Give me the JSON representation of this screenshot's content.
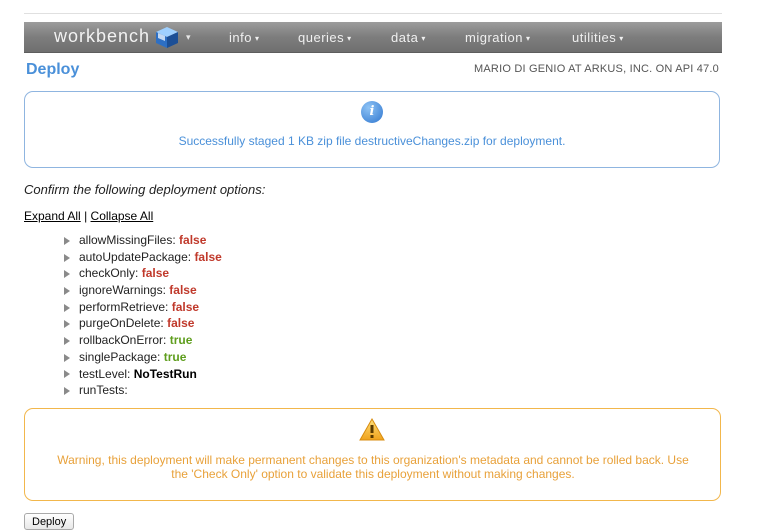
{
  "header": {
    "logo_text": "workbench",
    "nav_items": [
      "info",
      "queries",
      "data",
      "migration",
      "utilities"
    ],
    "caret": "▾"
  },
  "page": {
    "title": "Deploy",
    "user_info": "MARIO DI GENIO AT ARKUS, INC. ON API 47.0"
  },
  "info_box": {
    "icon": "info-icon",
    "message": "Successfully staged 1 KB zip file destructiveChanges.zip for deployment."
  },
  "confirm_text": "Confirm the following deployment options:",
  "links": {
    "expand_all": "Expand All",
    "separator": "|",
    "collapse_all": "Collapse All"
  },
  "options": [
    {
      "name": "allowMissingFiles:",
      "value": "false",
      "kind": "false"
    },
    {
      "name": "autoUpdatePackage:",
      "value": "false",
      "kind": "false"
    },
    {
      "name": "checkOnly:",
      "value": "false",
      "kind": "false"
    },
    {
      "name": "ignoreWarnings:",
      "value": "false",
      "kind": "false"
    },
    {
      "name": "performRetrieve:",
      "value": "false",
      "kind": "false"
    },
    {
      "name": "purgeOnDelete:",
      "value": "false",
      "kind": "false"
    },
    {
      "name": "rollbackOnError:",
      "value": "true",
      "kind": "true"
    },
    {
      "name": "singlePackage:",
      "value": "true",
      "kind": "true"
    },
    {
      "name": "testLevel:",
      "value": "NoTestRun",
      "kind": "plain"
    },
    {
      "name": "runTests:",
      "value": "",
      "kind": "plain"
    }
  ],
  "warning_box": {
    "icon": "warning-icon",
    "line1": "Warning, this deployment will make permanent changes to this organization's metadata and cannot be rolled back. Use",
    "line2": "the 'Check Only' option to validate this deployment without making changes."
  },
  "deploy_button": "Deploy",
  "colors": {
    "accent_blue": "#4a90d9",
    "false_red": "#c0392b",
    "true_green": "#5f9e1e",
    "warning_orange": "#e8a13a"
  }
}
